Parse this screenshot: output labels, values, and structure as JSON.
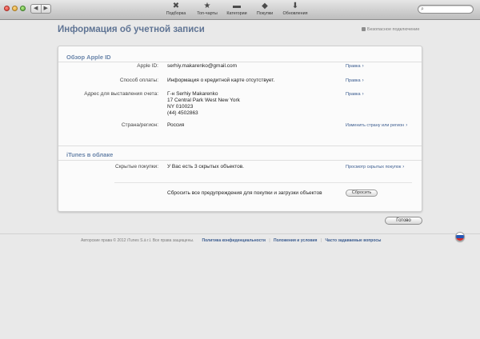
{
  "toolbar": {
    "items": [
      {
        "label": "Подборка",
        "icon": "✖"
      },
      {
        "label": "Топ-чарты",
        "icon": "★"
      },
      {
        "label": "Категории",
        "icon": "▬"
      },
      {
        "label": "Покупки",
        "icon": "◆"
      },
      {
        "label": "Обновления",
        "icon": "⬇"
      }
    ],
    "search_placeholder": ""
  },
  "page": {
    "title": "Информация об учетной записи",
    "secure_label": "Безопасное подключение"
  },
  "overview": {
    "heading": "Обзор Apple ID",
    "apple_id_label": "Apple ID:",
    "apple_id_value": "serhiy.makarenko@gmail.com",
    "apple_id_link": "Правка",
    "payment_label": "Способ оплаты:",
    "payment_value": "Информация о кредитной карте отсутствует.",
    "payment_link": "Правка",
    "billing_label": "Адрес для выставления счета:",
    "billing_lines": [
      "Г-н Serhiy Makarenko",
      "17 Central Park West New York",
      "NY 010023",
      "(44) 4502863"
    ],
    "billing_link": "Правка",
    "country_label": "Страна/регион:",
    "country_value": "Россия",
    "country_link": "Изменить страну или регион"
  },
  "cloud": {
    "heading": "iTunes в облаке",
    "hidden_label": "Скрытые покупки:",
    "hidden_value": "У Вас есть 3 скрытых объектов.",
    "hidden_link": "Просмотр скрытых покупок",
    "reset_text": "Сбросить все предупреждения для покупки и загрузки объектов",
    "reset_button": "Сбросить"
  },
  "done_button": "Готово",
  "footer": {
    "copyright": "Авторские права © 2012 iTunes S.à r.l. Все права защищены.",
    "links": [
      "Политика конфиденциальности",
      "Положения и условия",
      "Часто задаваемые вопросы"
    ]
  },
  "colors": {
    "title": "#5f7494",
    "section_heading": "#6a85aa",
    "link": "#3b5c8f"
  }
}
